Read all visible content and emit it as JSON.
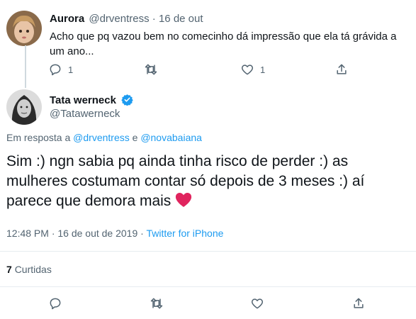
{
  "reply_tweet": {
    "author_name": "Aurora",
    "author_handle": "@drventress",
    "separator": "·",
    "date": "16 de out",
    "text": "Acho que pq vazou bem no comecinho dá impressão que ela tá grávida a um ano...",
    "reply_count": "1",
    "like_count": "1"
  },
  "main_tweet": {
    "author_name": "Tata werneck",
    "author_handle": "@Tatawerneck",
    "in_reply_prefix": "Em resposta a",
    "in_reply_user1": "@drventress",
    "in_reply_conj": "e",
    "in_reply_user2": "@novabaiana",
    "text": "Sim :) ngn sabia pq ainda tinha risco de perder :) as mulheres costumam contar só depois de 3 meses :) aí parece que demora mais",
    "emoji": "❤️",
    "timestamp": "12:48 PM · 16 de out de 2019",
    "ts_sep": "·",
    "source": "Twitter for iPhone",
    "likes_count": "7",
    "likes_label": "Curtidas"
  },
  "colors": {
    "accent": "#1d9bf0",
    "heart": "#e0245e",
    "muted": "#536471"
  }
}
